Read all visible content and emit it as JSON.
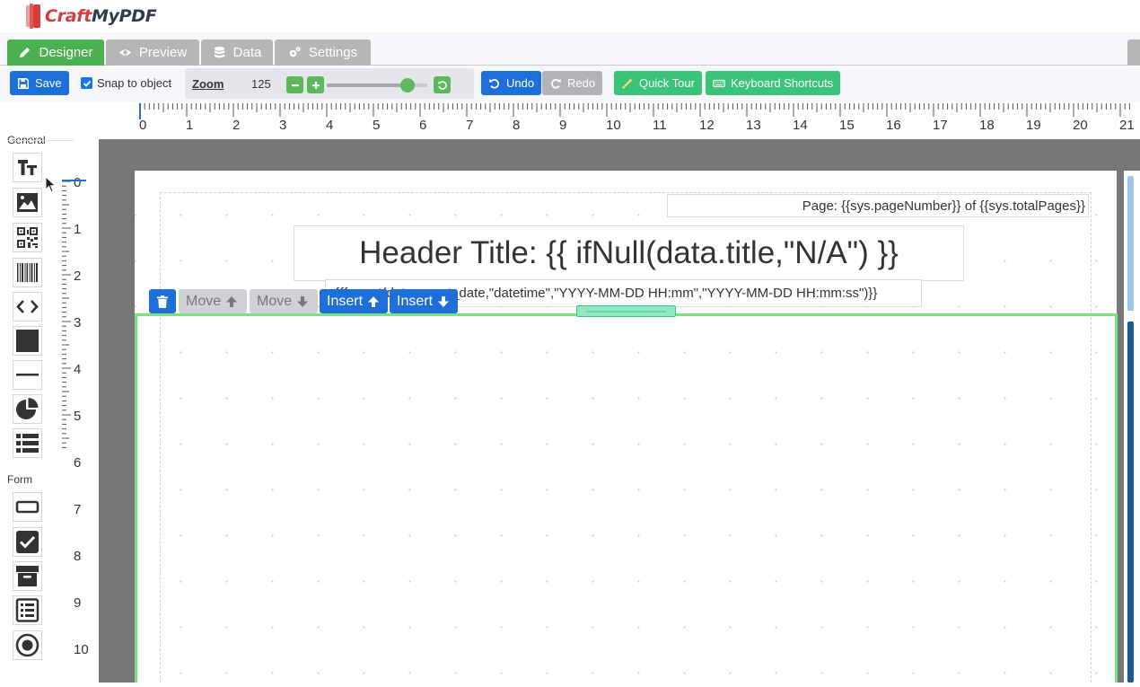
{
  "app": {
    "logo_part1": "Craft",
    "logo_part2": "MyPDF"
  },
  "tabs": [
    {
      "label": "Designer",
      "icon": "pencil-icon",
      "active": true
    },
    {
      "label": "Preview",
      "icon": "eye-icon",
      "active": false
    },
    {
      "label": "Data",
      "icon": "database-icon",
      "active": false
    },
    {
      "label": "Settings",
      "icon": "gears-icon",
      "active": false
    }
  ],
  "toolbar": {
    "save_label": "Save",
    "snap_label": "Snap to object",
    "snap_checked": true,
    "zoom_label": "Zoom",
    "zoom_value": "125",
    "zoom_slider_fraction": 0.8,
    "undo_label": "Undo",
    "redo_label": "Redo",
    "tour_label": "Quick Tour",
    "shortcuts_label": "Keyboard Shortcuts"
  },
  "ruler": {
    "top_labels": [
      "0",
      "1",
      "2",
      "3",
      "4",
      "5",
      "6",
      "7",
      "8",
      "9",
      "10",
      "11",
      "12",
      "13",
      "14",
      "15",
      "16",
      "17",
      "18",
      "19",
      "20",
      "21"
    ],
    "left_labels": [
      "0",
      "1",
      "2",
      "3",
      "4",
      "5",
      "6",
      "7",
      "8",
      "9",
      "10"
    ]
  },
  "palette": {
    "general_label": "General",
    "form_label": "Form",
    "general_items": [
      "text-icon",
      "image-icon",
      "qrcode-icon",
      "barcode-icon",
      "code-icon",
      "rectangle-icon",
      "line-icon",
      "chart-pie-icon",
      "table-icon"
    ],
    "form_items": [
      "textbox-icon",
      "checkbox-icon",
      "combobox-icon",
      "listbox-icon",
      "radio-icon"
    ]
  },
  "canvas": {
    "page_number_text": "Page: {{sys.pageNumber}} of {{sys.totalPages}}",
    "header_title_text": "Header Title: {{ ifNull(data.title,\"N/A\") }}",
    "date_text": "{{format(data.report_date,\"datetime\",\"YYYY-MM-DD HH:mm\",\"YYYY-MM-DD HH:mm:ss\")}}",
    "move_up_label": "Move",
    "move_down_label": "Move",
    "insert_up_label": "Insert",
    "insert_down_label": "Insert"
  },
  "colors": {
    "designer_tab": "#4caf50",
    "inactive_tab": "#b6b6b6",
    "primary_button": "#1e6fd9",
    "success_button": "#3cc37a",
    "band_border": "#7fe07f"
  }
}
